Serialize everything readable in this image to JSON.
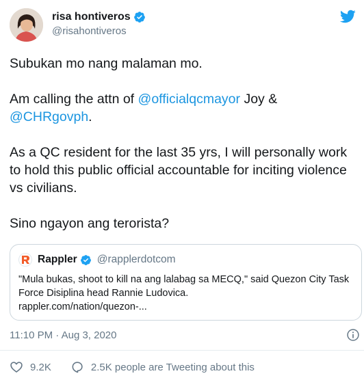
{
  "tweet": {
    "author": {
      "display_name": "risa hontiveros",
      "handle": "@risahontiveros",
      "avatar_icon": "profile-photo"
    },
    "paragraphs": [
      {
        "parts": [
          {
            "text": "Subukan mo nang malaman mo."
          }
        ]
      },
      {
        "parts": [
          {
            "text": "Am calling the attn of "
          },
          {
            "text": "@officialqcmayor",
            "mention": true
          },
          {
            "text": " Joy & "
          },
          {
            "text": "@CHRgovph",
            "mention": true
          },
          {
            "text": "."
          }
        ]
      },
      {
        "parts": [
          {
            "text": "As a QC resident for the last 35 yrs, I will personally work to hold this public official accountable for inciting violence vs civilians."
          }
        ]
      },
      {
        "parts": [
          {
            "text": "Sino ngayon ang terorista?"
          }
        ]
      }
    ],
    "timestamp": "11:10 PM · Aug 3, 2020",
    "likes": "9.2K",
    "retweets_text": "2.5K people are Tweeting about this"
  },
  "quote": {
    "name": "Rappler",
    "handle": "@rapplerdotcom",
    "text": "\"Mula bukas, shoot to kill na ang lalabag sa MECQ,\" said Quezon City Task Force Disiplina head Rannie Ludovica.",
    "link": "rappler.com/nation/quezon-..."
  },
  "colors": {
    "text": "#14171a",
    "secondary": "#657786",
    "mention": "#1b95e0",
    "brand": "#1da1f2",
    "rappler_orange": "#f25c2a"
  },
  "icons": {
    "verified": "verified-badge-icon",
    "logo": "twitter-bird-icon",
    "info": "info-icon",
    "like": "heart-icon",
    "reply": "speech-bubble-icon"
  }
}
